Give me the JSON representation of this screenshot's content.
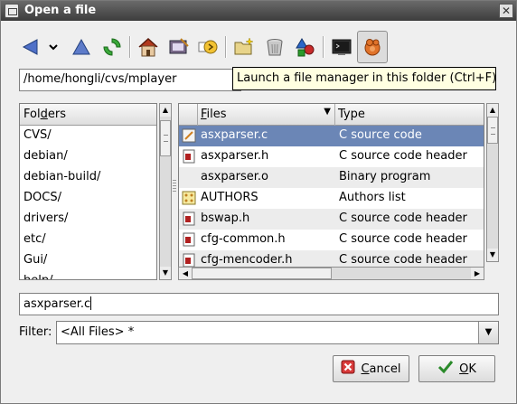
{
  "window": {
    "title": "Open a file"
  },
  "toolbar": {
    "icons": [
      "back-icon",
      "history-dropdown-icon",
      "up-icon",
      "refresh-icon",
      "home-icon",
      "bookmarks-icon",
      "go-icon",
      "new-folder-icon",
      "delete-icon",
      "properties-icon",
      "terminal-icon",
      "file-manager-icon"
    ]
  },
  "path": {
    "value": "/home/hongli/cvs/mplayer"
  },
  "tooltip": {
    "text": "Launch a file manager in this folder  (Ctrl+F)"
  },
  "folders": {
    "header_prefix": "Fol",
    "header_accel": "d",
    "header_suffix": "ers",
    "items": [
      "CVS/",
      "debian/",
      "debian-build/",
      "DOCS/",
      "drivers/",
      "etc/",
      "Gui/",
      "help/"
    ]
  },
  "files": {
    "header_files_accel": "F",
    "header_files_rest": "iles",
    "header_type": "Type",
    "rows": [
      {
        "name": "asxparser.c",
        "type": "C source code",
        "icon": "c-source-icon",
        "selected": true
      },
      {
        "name": "asxparser.h",
        "type": "C source code header",
        "icon": "c-header-icon"
      },
      {
        "name": "asxparser.o",
        "type": "Binary program",
        "icon": ""
      },
      {
        "name": "AUTHORS",
        "type": "Authors list",
        "icon": "authors-icon"
      },
      {
        "name": "bswap.h",
        "type": "C source code header",
        "icon": "c-header-icon"
      },
      {
        "name": "cfg-common.h",
        "type": "C source code header",
        "icon": "c-header-icon"
      },
      {
        "name": "cfg-mencoder.h",
        "type": "C source code header",
        "icon": "c-header-icon"
      }
    ]
  },
  "filename": {
    "value": "asxparser.c"
  },
  "filter": {
    "label": "Filter:",
    "value": "<All Files> *"
  },
  "buttons": {
    "cancel_accel": "C",
    "cancel_rest": "ancel",
    "ok_accel": "O",
    "ok_rest": "K"
  },
  "colors": {
    "selection": "#6b86b6",
    "tooltip_bg": "#ffffe1",
    "titlebar": "#4a4a4a"
  }
}
